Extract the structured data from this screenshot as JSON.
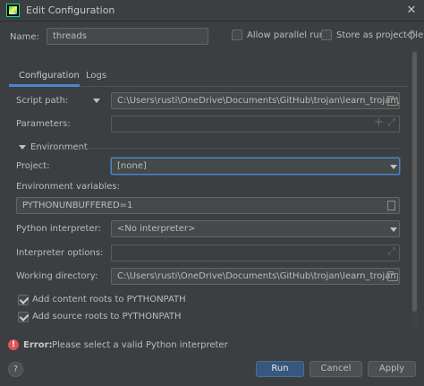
{
  "window": {
    "title": "Edit Configuration",
    "close": "✕"
  },
  "name_row": {
    "label": "Name:",
    "value": "threads",
    "allow_parallel": "Allow parallel run",
    "store_project": "Store as project file"
  },
  "tabs": [
    {
      "label": "Configuration"
    },
    {
      "label": "Logs"
    }
  ],
  "script": {
    "label": "Script path:",
    "value": "C:\\Users\\rusti\\OneDrive\\Documents\\GitHub\\trojan\\learn_trojan\\threads.py"
  },
  "parameters": {
    "label": "Parameters:",
    "value": ""
  },
  "environment": {
    "section": "Environment",
    "project_label": "Project:",
    "project_value": "[none]",
    "env_vars_label": "Environment variables:",
    "env_vars_value": "PYTHONUNBUFFERED=1"
  },
  "interpreter": {
    "label": "Python interpreter:",
    "value": "<No interpreter>"
  },
  "interpreter_options": {
    "label": "Interpreter options:",
    "value": ""
  },
  "workdir": {
    "label": "Working directory:",
    "value": "C:\\Users\\rusti\\OneDrive\\Documents\\GitHub\\trojan\\learn_trojan"
  },
  "checks": {
    "content_roots": "Add content roots to PYTHONPATH",
    "source_roots": "Add source roots to PYTHONPATH"
  },
  "error": {
    "prefix": "Error:",
    "message": "Please select a valid Python interpreter"
  },
  "buttons": {
    "help": "?",
    "run": "Run",
    "cancel": "Cancel",
    "apply": "Apply"
  },
  "colors": {
    "accent": "#4a88c7",
    "error": "#e05555",
    "primary_button": "#365880",
    "focus_border": "#4a88c7"
  }
}
